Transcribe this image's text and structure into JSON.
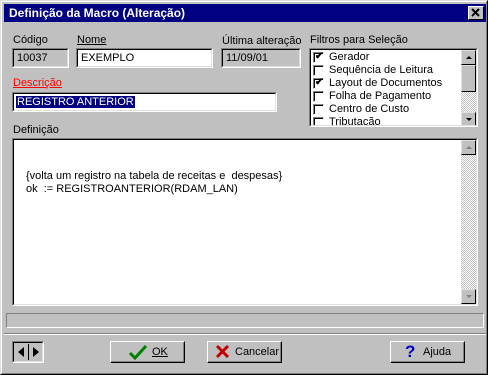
{
  "window": {
    "title": "Definição da Macro (Alteração)"
  },
  "fields": {
    "codigo_label": "Código",
    "codigo_value": "10037",
    "nome_label": "Nome",
    "nome_value": "EXEMPLO",
    "ultima_label": "Última alteração",
    "ultima_value": "11/09/01",
    "descricao_label": "Descrição",
    "descricao_value": "REGISTRO ANTERIOR",
    "descricao_color": "#ff0000",
    "definicao_label": "Definição"
  },
  "filters": {
    "label": "Filtros para Seleção",
    "items": [
      {
        "label": "Gerador",
        "checked": true
      },
      {
        "label": "Sequência de Leitura",
        "checked": false
      },
      {
        "label": "Layout de Documentos",
        "checked": true
      },
      {
        "label": "Folha de Pagamento",
        "checked": false
      },
      {
        "label": "Centro de Custo",
        "checked": false
      },
      {
        "label": "Tributação",
        "checked": false
      }
    ]
  },
  "definition": {
    "lines": [
      "{volta um registro na tabela de receitas e  despesas}",
      "ok  := REGISTROANTERIOR(RDAM_LAN)"
    ]
  },
  "buttons": {
    "ok_label": "OK",
    "cancel_label": "Cancelar",
    "help_label": "Ajuda"
  },
  "colors": {
    "titlebar": "#000080",
    "selection": "#000080",
    "ok_icon": "#008000",
    "cancel_icon": "#c00000",
    "help_icon": "#0000c0"
  },
  "icons": [
    "close-icon",
    "scroll-up-icon",
    "scroll-down-icon",
    "nav-left-icon",
    "nav-right-icon",
    "check-icon",
    "x-icon",
    "question-icon"
  ]
}
